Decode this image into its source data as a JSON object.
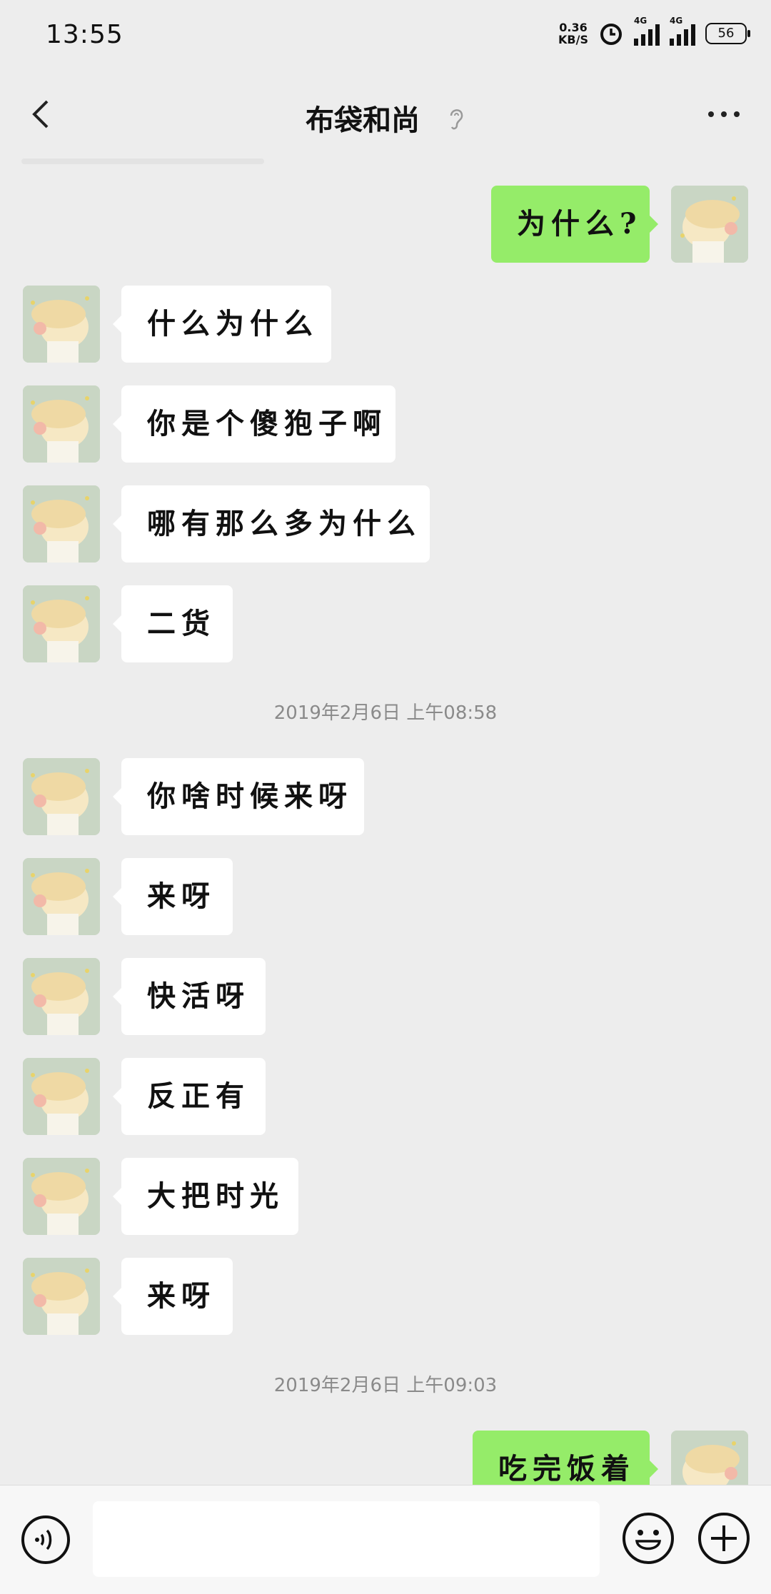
{
  "status_bar": {
    "time": "13:55",
    "net_speed_value": "0.36",
    "net_speed_unit": "KB/S",
    "signal1_label": "4G",
    "signal2_label": "4G",
    "battery": "56"
  },
  "header": {
    "title": "布袋和尚"
  },
  "messages": [
    {
      "side": "out",
      "text": "为什么?"
    },
    {
      "side": "in",
      "text": "什么为什么"
    },
    {
      "side": "in",
      "text": "你是个傻狍子啊"
    },
    {
      "side": "in",
      "text": "哪有那么多为什么"
    },
    {
      "side": "in",
      "text": "二货"
    },
    {
      "side": "in",
      "text": "你啥时候来呀"
    },
    {
      "side": "in",
      "text": "来呀"
    },
    {
      "side": "in",
      "text": "快活呀"
    },
    {
      "side": "in",
      "text": "反正有"
    },
    {
      "side": "in",
      "text": "大把时光"
    },
    {
      "side": "in",
      "text": "来呀"
    },
    {
      "side": "out",
      "text": "吃完饭着"
    }
  ],
  "timestamps": [
    "2019年2月6日 上午08:58",
    "2019年2月6日 上午09:03"
  ],
  "colors": {
    "background": "#ededed",
    "out_bubble": "#95ec69",
    "in_bubble": "#ffffff",
    "timestamp_text": "#8a8a8a"
  },
  "icons": {
    "back": "chevron-left-icon",
    "ear": "ear-icon",
    "more": "more-dots-icon",
    "voice": "voice-input-icon",
    "emoji": "emoji-icon",
    "plus": "plus-icon"
  }
}
